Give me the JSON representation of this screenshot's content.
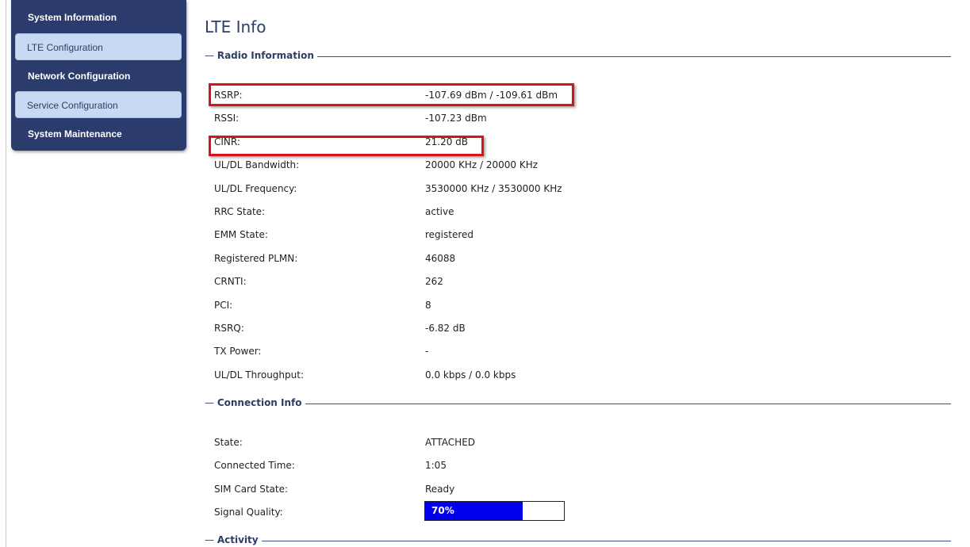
{
  "sidebar": {
    "items": [
      {
        "label": "System Information"
      },
      {
        "label": "LTE Configuration"
      },
      {
        "label": "Network Configuration"
      },
      {
        "label": "Service Configuration"
      },
      {
        "label": "System Maintenance"
      }
    ]
  },
  "page": {
    "title": "LTE Info"
  },
  "sections": {
    "radio": {
      "title": "Radio Information",
      "rows": [
        {
          "label": "RSRP:",
          "value": "-107.69 dBm / -109.61 dBm"
        },
        {
          "label": "RSSI:",
          "value": "-107.23 dBm"
        },
        {
          "label": "CINR:",
          "value": "21.20 dB"
        },
        {
          "label": "UL/DL Bandwidth:",
          "value": "20000 KHz / 20000 KHz"
        },
        {
          "label": "UL/DL Frequency:",
          "value": "3530000 KHz / 3530000 KHz"
        },
        {
          "label": "RRC State:",
          "value": "active"
        },
        {
          "label": "EMM State:",
          "value": "registered"
        },
        {
          "label": "Registered PLMN:",
          "value": "46088"
        },
        {
          "label": "CRNTI:",
          "value": "262"
        },
        {
          "label": "PCI:",
          "value": "8"
        },
        {
          "label": "RSRQ:",
          "value": "-6.82 dB"
        },
        {
          "label": "TX Power:",
          "value": "-"
        },
        {
          "label": "UL/DL Throughput:",
          "value": "0.0 kbps / 0.0 kbps"
        }
      ]
    },
    "connection": {
      "title": "Connection Info",
      "rows": [
        {
          "label": "State:",
          "value": "ATTACHED"
        },
        {
          "label": "Connected Time:",
          "value": "1:05"
        },
        {
          "label": "SIM Card State:",
          "value": "Ready"
        },
        {
          "label": "Signal Quality:",
          "value": ""
        }
      ],
      "signal_quality": {
        "text": "70%",
        "fraction": 0.7
      }
    },
    "activity": {
      "title": "Activity"
    }
  },
  "colors": {
    "highlight": "#d9131b",
    "bar_fill": "#0000ee",
    "sidebar": "#2b3b6b"
  }
}
